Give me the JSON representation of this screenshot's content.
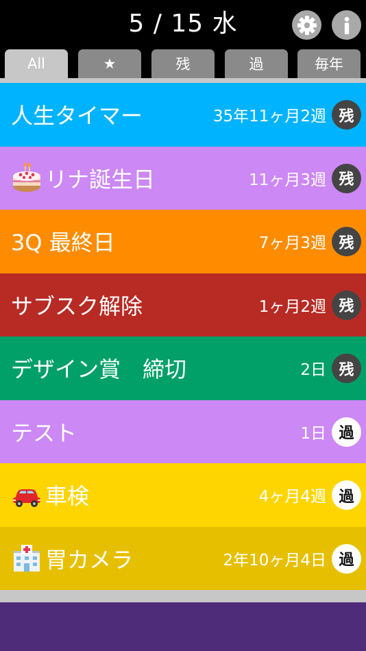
{
  "header": {
    "date": "5 / 15 水",
    "settings_icon": "gear-icon",
    "info_icon": "info-icon"
  },
  "tabs": [
    {
      "label": "All",
      "active": true
    },
    {
      "label": "★",
      "active": false
    },
    {
      "label": "残",
      "active": false
    },
    {
      "label": "過",
      "active": false
    },
    {
      "label": "毎年",
      "active": false
    }
  ],
  "timers": [
    {
      "title": "人生タイマー",
      "time": "35年11ヶ月2週",
      "badge": "残",
      "color": "#00b3ff",
      "emoji": ""
    },
    {
      "title": "リナ誕生日",
      "time": "11ヶ月3週",
      "badge": "残",
      "color": "#cc88f5",
      "emoji": "cake-icon"
    },
    {
      "title": "3Q 最終日",
      "time": "7ヶ月3週",
      "badge": "残",
      "color": "#ff8c00",
      "emoji": ""
    },
    {
      "title": "サブスク解除",
      "time": "1ヶ月2週",
      "badge": "残",
      "color": "#b72b24",
      "emoji": ""
    },
    {
      "title": "デザイン賞　締切",
      "time": "2日",
      "badge": "残",
      "color": "#00a068",
      "emoji": ""
    },
    {
      "title": "テスト",
      "time": "1日",
      "badge": "過",
      "color": "#cc88f5",
      "emoji": ""
    },
    {
      "title": "車検",
      "time": "4ヶ月4週",
      "badge": "過",
      "color": "#ffd500",
      "emoji": "car-icon"
    },
    {
      "title": "胃カメラ",
      "time": "2年10ヶ月4日",
      "badge": "過",
      "color": "#e6c000",
      "emoji": "hospital-icon"
    }
  ],
  "colors": {
    "tab_active": "#c7c7c7",
    "tab_inactive": "#8a8a8a",
    "footer": "#4f2c7a",
    "badge_remaining": "#444444",
    "badge_past": "#ffffff"
  }
}
